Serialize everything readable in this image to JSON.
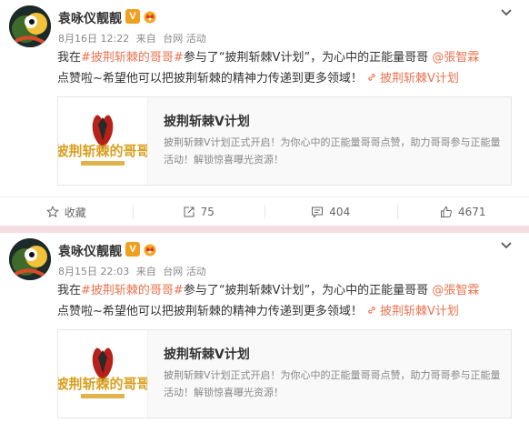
{
  "posts": [
    {
      "user_name": "袁咏仪靓靓",
      "verified_badge": "V",
      "meta": {
        "date": "8月16日 12:22",
        "source_prefix": "来自",
        "source": "台网 活动"
      },
      "text": {
        "part1": "我在",
        "topic": "#披荆斩棘的哥哥#",
        "part2": "参与了“披荆斩棘V计划”，为心中的正能量哥哥 ",
        "mention": "@張智霖",
        "part3": "点赞啦~希望他可以把披荆斩棘的精神力传递到更多领域！ ",
        "link": "披荆斩棘V计划"
      },
      "card": {
        "title": "披荆斩棘V计划",
        "description": "披荆斩棘V计划正式开启！为你心中的正能量哥哥点赞，助力哥哥参与正能量活动！解锁惊喜曝光资源！",
        "thumb_text": "披荆斩棘的哥哥"
      },
      "actions": {
        "favorite": "收藏",
        "repost": "75",
        "comment": "404",
        "like": "4671"
      }
    },
    {
      "user_name": "袁咏仪靓靓",
      "verified_badge": "V",
      "meta": {
        "date": "8月15日 22:03",
        "source_prefix": "来自",
        "source": "台网 活动"
      },
      "text": {
        "part1": "我在",
        "topic": "#披荆斩棘的哥哥#",
        "part2": "参与了“披荆斩棘V计划”，为心中的正能量哥哥 ",
        "mention": "@張智霖",
        "part3": "点赞啦~希望他可以把披荆斩棘的精神力传递到更多领域！ ",
        "link": "披荆斩棘V计划"
      },
      "card": {
        "title": "披荆斩棘V计划",
        "description": "披荆斩棘V计划正式开启！为你心中的正能量哥哥点赞，助力哥哥参与正能量活动！解锁惊喜曝光资源！",
        "thumb_text": "披荆斩棘的哥哥"
      }
    }
  ],
  "colors": {
    "accent": "#eb7350",
    "divider": "#f5dde2",
    "badge": "#f0a020"
  }
}
